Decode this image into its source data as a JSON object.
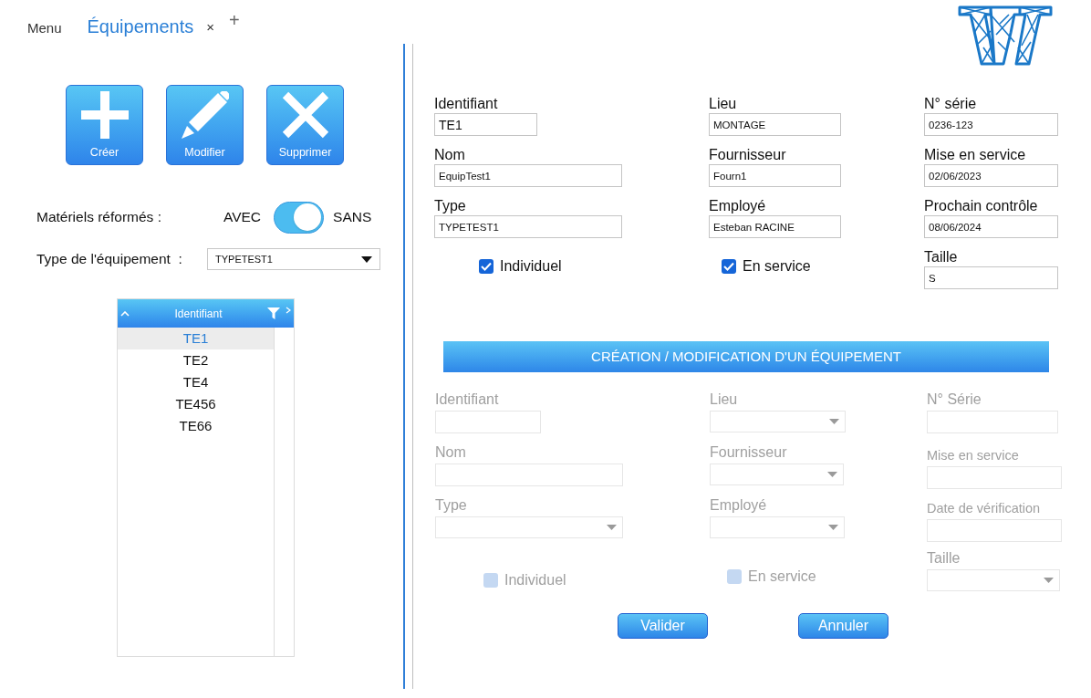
{
  "tabs": [
    {
      "label": "Menu",
      "selected": false
    },
    {
      "label": "Équipements",
      "selected": true
    }
  ],
  "tab_close": "×",
  "new_tab": "+",
  "actions": [
    {
      "label": "Créer",
      "kind": "plus"
    },
    {
      "label": "Modifier",
      "kind": "pencil"
    },
    {
      "label": "Supprimer",
      "kind": "cross"
    }
  ],
  "retired_filter": {
    "label": "Matériels réformés :",
    "left_text": "AVEC",
    "right_text": "SANS",
    "on": true
  },
  "type_filter": {
    "label": "Type de l'équipement  :",
    "value": "TYPETEST1"
  },
  "list": {
    "column": "Identifiant",
    "rows": [
      {
        "text": "TE1",
        "selected": true
      },
      {
        "text": "TE2",
        "selected": false
      },
      {
        "text": "TE4",
        "selected": false
      },
      {
        "text": "TE456",
        "selected": false
      },
      {
        "text": "TE66",
        "selected": false
      }
    ]
  },
  "details": {
    "columns": [
      [
        {
          "label": "Identifiant",
          "value": "TE1"
        },
        {
          "label": "Nom",
          "value": "EquipTest1"
        },
        {
          "label": "Type",
          "value": "TYPETEST1"
        }
      ],
      [
        {
          "label": "Lieu",
          "value": "MONTAGE"
        },
        {
          "label": "Fournisseur",
          "value": "Fourn1"
        },
        {
          "label": "Employé",
          "value": "Esteban RACINE"
        }
      ],
      [
        {
          "label": "N° série",
          "value": "0236-123"
        },
        {
          "label": "Mise en service",
          "value": "02/06/2023"
        },
        {
          "label": "Prochain contrôle",
          "value": "08/06/2024"
        },
        {
          "label": "Taille",
          "value": "S"
        }
      ]
    ],
    "checkboxes": [
      {
        "label": "Individuel",
        "checked": true
      },
      {
        "label": "En service",
        "checked": true
      }
    ]
  },
  "editor": {
    "title": "CRÉATION / MODIFICATION D'UN ÉQUIPEMENT",
    "disabled": true,
    "columns": [
      [
        {
          "label": "Identifiant",
          "kind": "text"
        },
        {
          "label": "Nom",
          "kind": "text"
        },
        {
          "label": "Type",
          "kind": "dropdown"
        }
      ],
      [
        {
          "label": "Lieu",
          "kind": "dropdown"
        },
        {
          "label": "Fournisseur",
          "kind": "dropdown"
        },
        {
          "label": "Employé",
          "kind": "dropdown"
        }
      ],
      [
        {
          "label": "N° Série",
          "kind": "text"
        },
        {
          "label": "Mise en service",
          "kind": "text"
        },
        {
          "label": "Date de vérification",
          "kind": "text"
        },
        {
          "label": "Taille",
          "kind": "dropdown"
        }
      ]
    ],
    "checkboxes": [
      {
        "label": "Individuel",
        "checked": false
      },
      {
        "label": "En service",
        "checked": false
      }
    ],
    "buttons": [
      "Valider",
      "Annuler"
    ]
  }
}
